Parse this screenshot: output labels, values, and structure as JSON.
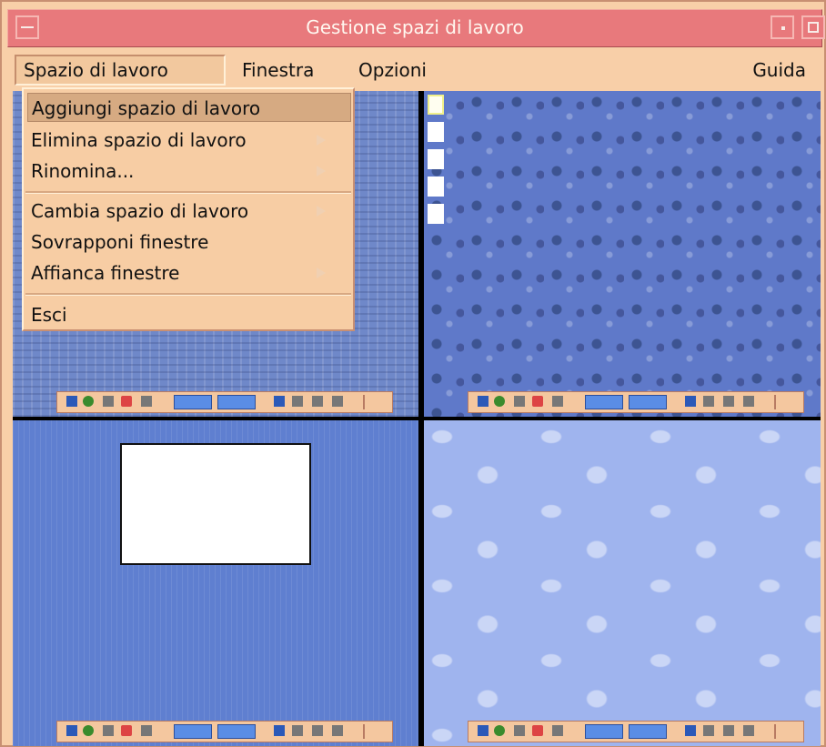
{
  "window": {
    "title": "Gestione spazi di lavoro"
  },
  "menubar": {
    "items": [
      {
        "label": "Spazio di lavoro"
      },
      {
        "label": "Finestra"
      },
      {
        "label": "Opzioni"
      },
      {
        "label": "Guida"
      }
    ]
  },
  "dropdown": {
    "items": [
      {
        "label": "Aggiungi spazio di lavoro"
      },
      {
        "label": "Elimina spazio di lavoro"
      },
      {
        "label": "Rinomina..."
      },
      {
        "label": "Cambia spazio di lavoro"
      },
      {
        "label": "Sovrapponi finestre"
      },
      {
        "label": "Affianca finestre"
      },
      {
        "label": "Esci"
      }
    ]
  },
  "workspaces": [
    {
      "name": "workspace-1",
      "background": "stone-pattern"
    },
    {
      "name": "workspace-2",
      "background": "water-drops"
    },
    {
      "name": "workspace-3",
      "background": "blue-dots"
    },
    {
      "name": "workspace-4",
      "background": "dolphins"
    }
  ],
  "colors": {
    "title_bar": "#e8797c",
    "menu_bar": "#f8cfa8",
    "desktop_border": "#000000"
  }
}
